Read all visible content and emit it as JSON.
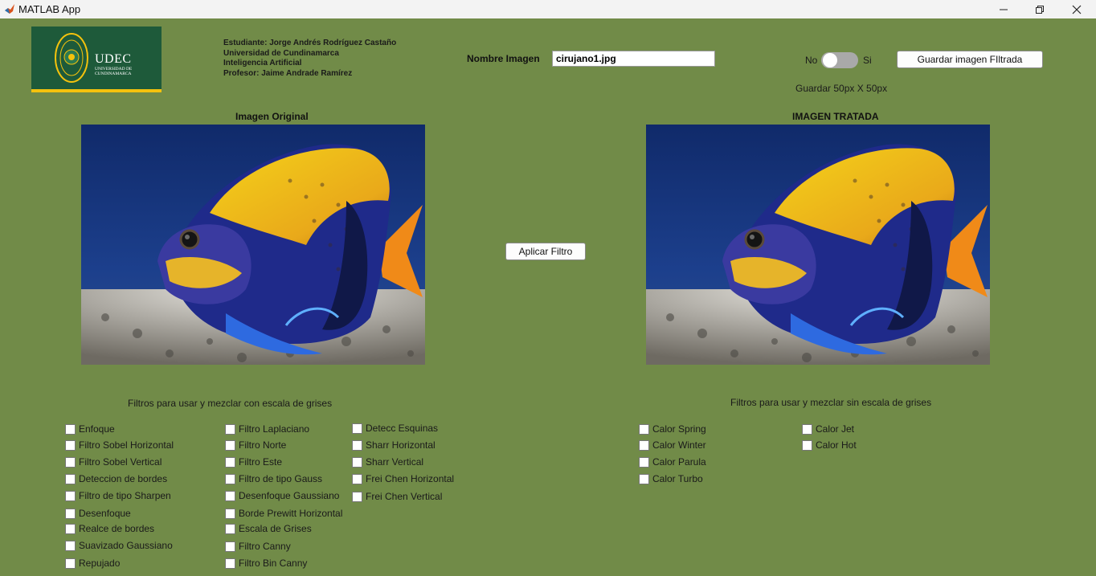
{
  "window": {
    "title": "MATLAB App"
  },
  "logo": {
    "name": "UDEC",
    "subtitle": "UNIVERSIDAD DE CUNDINAMARCA"
  },
  "info": {
    "line1": "Estudiante: Jorge Andrés Rodríguez Castaño",
    "line2": "Universidad de Cundinamarca",
    "line3": "Inteligencia Artificial",
    "line4": "Profesor: Jaime Andrade Ramírez"
  },
  "filename": {
    "label": "Nombre Imagen",
    "value": "cirujano1.jpg"
  },
  "toggle": {
    "off_label": "No",
    "on_label": "Si",
    "state": "off"
  },
  "save_button": "Guardar imagen FIltrada",
  "save_size": "Guardar 50px X 50px",
  "original_title": "Imagen Original",
  "treated_title": "IMAGEN TRATADA",
  "apply_button": "Aplicar Filtro",
  "gray_section": {
    "title": "Filtros para usar y mezclar con escala de grises",
    "col1": [
      "Enfoque",
      "Filtro Sobel Horizontal",
      "Filtro Sobel Vertical",
      "Deteccion de bordes",
      "Filtro de tipo Sharpen",
      "Desenfoque",
      "Realce de bordes",
      "Suavizado Gaussiano",
      "Repujado"
    ],
    "col2": [
      "Filtro Laplaciano",
      "Filtro Norte",
      "Filtro Este",
      "Filtro de tipo Gauss",
      "Desenfoque Gaussiano",
      "Borde Prewitt Horizontal",
      "Escala de Grises",
      "Filtro Canny",
      "Filtro Bin Canny"
    ],
    "col3": [
      "Detecc Esquinas",
      "Sharr Horizontal",
      "Sharr Vertical",
      "Frei Chen Horizontal",
      "Frei Chen Vertical"
    ]
  },
  "color_section": {
    "title": "Filtros para usar y mezclar sin escala de grises",
    "col1": [
      "Calor Spring",
      "Calor Winter",
      "Calor Parula",
      "Calor Turbo"
    ],
    "col2": [
      "Calor Jet",
      "Calor Hot"
    ]
  },
  "colors": {
    "background": "#718b48",
    "logo_green": "#1e5a3a",
    "logo_gold": "#f4c20d"
  }
}
